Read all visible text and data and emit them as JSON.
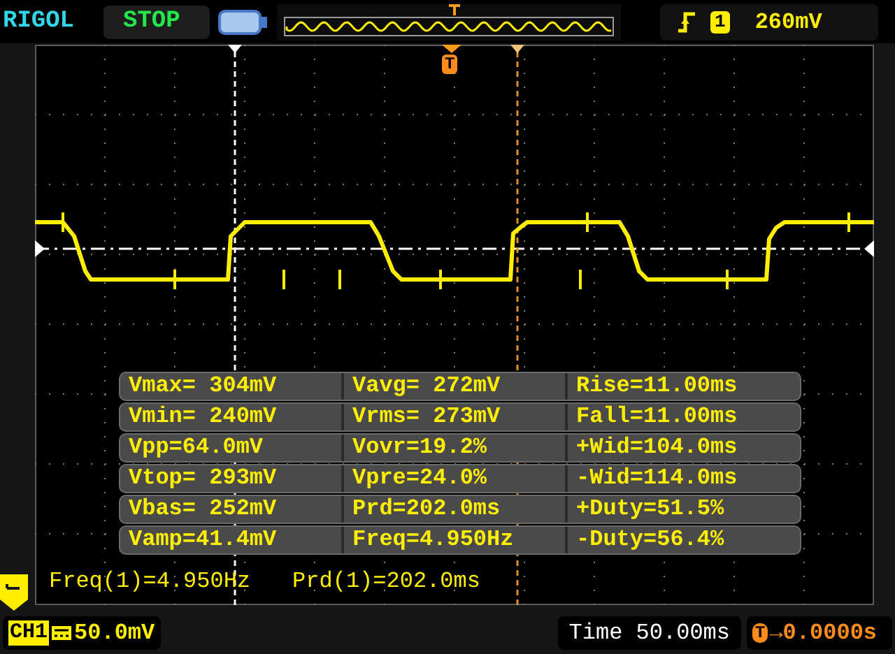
{
  "brand": "RIGOL",
  "run_state": "STOP",
  "trigger": {
    "badge": "1",
    "level": "260mV"
  },
  "trigger_marker": "T",
  "measurements": [
    [
      "Vmax= 304mV",
      "Vavg= 272mV",
      "Rise=11.00ms"
    ],
    [
      "Vmin= 240mV",
      "Vrms= 273mV",
      "Fall=11.00ms"
    ],
    [
      "Vpp=64.0mV",
      "Vovr=19.2%",
      "+Wid=104.0ms"
    ],
    [
      "Vtop= 293mV",
      "Vpre=24.0%",
      "-Wid=114.0ms"
    ],
    [
      "Vbas= 252mV",
      "Prd=202.0ms",
      "+Duty=51.5%"
    ],
    [
      "Vamp=41.4mV",
      "Freq=4.950Hz",
      "-Duty=56.4%"
    ]
  ],
  "readouts": [
    "Freq(1)=4.950Hz",
    "Prd(1)=202.0ms"
  ],
  "channel": {
    "label": "CH1",
    "scale": "50.0mV"
  },
  "timebase": "Time 50.00ms",
  "trigger_offset": {
    "badge": "T",
    "value": "→0.0000s"
  }
}
